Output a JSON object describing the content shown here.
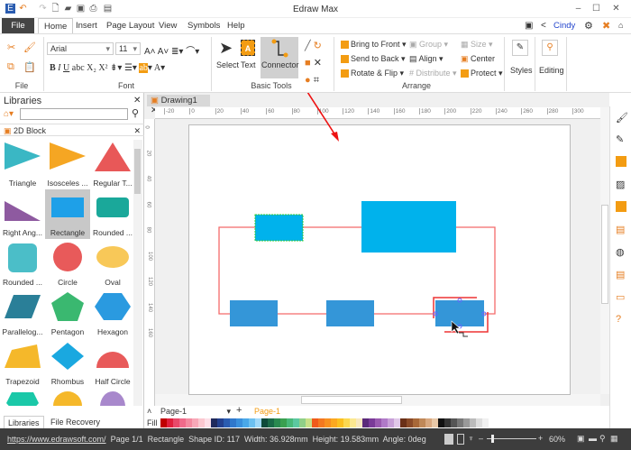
{
  "app": {
    "title": "Edraw Max"
  },
  "menu": {
    "file": "File",
    "tabs": [
      "Home",
      "Insert",
      "Page Layout",
      "View",
      "Symbols",
      "Help"
    ],
    "user": "Cindy"
  },
  "ribbon": {
    "groups": {
      "file": "File",
      "font": "Font",
      "basic_tools": "Basic Tools",
      "arrange": "Arrange"
    },
    "font_name": "Arial",
    "font_size": "11",
    "tools": {
      "select": "Select",
      "text": "Text",
      "connector": "Connector"
    },
    "arrange": {
      "bring_front": "Bring to Front",
      "send_back": "Send to Back",
      "rotate": "Rotate & Flip",
      "group": "Group",
      "align": "Align",
      "distribute": "Distribute",
      "size": "Size",
      "center": "Center",
      "protect": "Protect"
    },
    "styles": "Styles",
    "editing": "Editing"
  },
  "libraries": {
    "title": "Libraries",
    "category": "2D Block",
    "shapes": [
      "Triangle",
      "Isosceles ...",
      "Regular T...",
      "Right Ang...",
      "Rectangle",
      "Rounded ...",
      "Rounded ...",
      "Circle",
      "Oval",
      "Parallelog...",
      "Pentagon",
      "Hexagon",
      "Trapezoid",
      "Rhombus",
      "Half Circle",
      "",
      "",
      ""
    ],
    "tabs": [
      "Libraries",
      "File Recovery"
    ]
  },
  "document": {
    "tab": "Drawing1",
    "ruler_h": [
      "-20",
      "0",
      "20",
      "40",
      "60",
      "80",
      "100",
      "120",
      "140",
      "160",
      "180",
      "200",
      "220",
      "240",
      "260",
      "280",
      "300"
    ],
    "ruler_v": [
      "0",
      "20",
      "40",
      "60",
      "80",
      "100",
      "120",
      "140",
      "160"
    ]
  },
  "pages": {
    "selector": "Page-1",
    "active": "Page-1",
    "fill_label": "Fill"
  },
  "palette": [
    "#c00000",
    "#e0203c",
    "#e84a6a",
    "#f06a8a",
    "#f48aa0",
    "#f8a8b8",
    "#fbc8d0",
    "#fde0e8",
    "#1f2a5c",
    "#23408e",
    "#2a5cb0",
    "#2f78cc",
    "#3a90dc",
    "#4aa8e8",
    "#6cc0f0",
    "#a0d8f8",
    "#0d4a3a",
    "#1a6a48",
    "#2a8a50",
    "#3aa050",
    "#48b878",
    "#5cc8a0",
    "#90d088",
    "#c8e088",
    "#f05a1a",
    "#f47820",
    "#f89020",
    "#fca820",
    "#fcc020",
    "#fcd850",
    "#fce890",
    "#f8e8c0",
    "#5a2a7a",
    "#7a3a98",
    "#9a5ab0",
    "#b07ac8",
    "#c8a0d8",
    "#e0c8e8",
    "#6a3018",
    "#8a4a28",
    "#a86838",
    "#c08858",
    "#d8a880",
    "#e8c8a8",
    "#111111",
    "#333333",
    "#555555",
    "#777777",
    "#999999",
    "#bbbbbb",
    "#dddddd",
    "#f0f0f0"
  ],
  "status": {
    "url": "https://www.edrawsoft.com/",
    "page": "Page 1/1",
    "shape": "Rectangle",
    "shape_id": "Shape ID: 117",
    "width": "Width: 36.928mm",
    "height": "Height: 19.583mm",
    "angle": "Angle: 0deg",
    "zoom": "60%"
  },
  "colors": {
    "accent": "#f39c12",
    "shape_cyan": "#00b2ec",
    "shape_blue": "#3496d8",
    "connector": "#f46a6a"
  }
}
